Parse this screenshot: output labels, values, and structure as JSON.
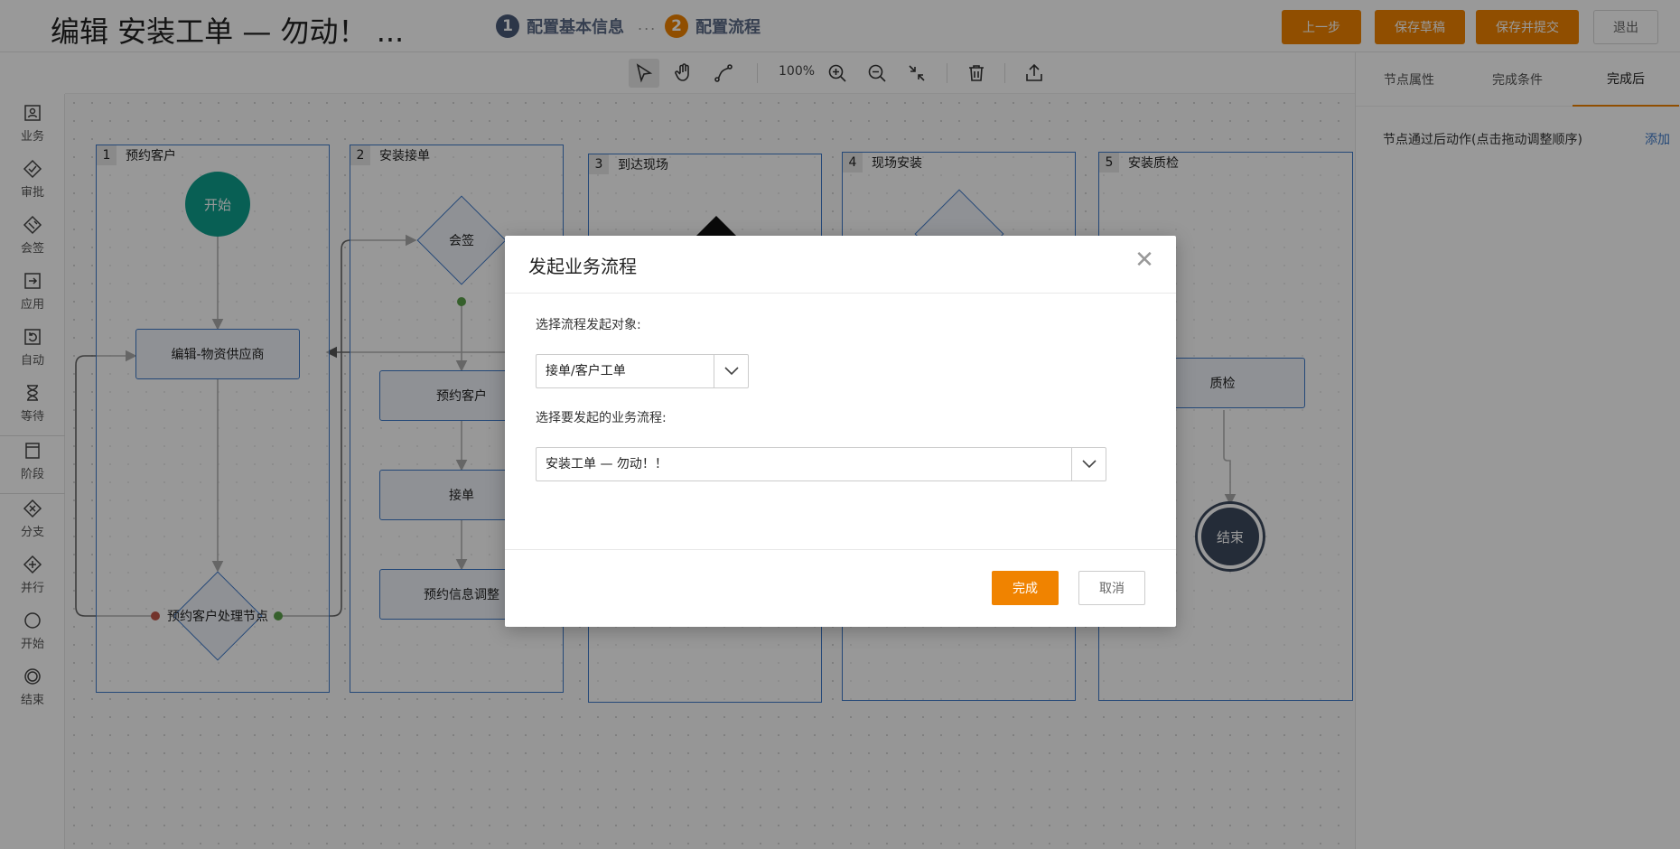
{
  "header": {
    "title": "编辑 安装工单 — 勿动！ ...",
    "steps": [
      {
        "num": "1",
        "label": "配置基本信息"
      },
      {
        "num": "2",
        "label": "配置流程"
      }
    ],
    "step_sep": "...",
    "buttons": {
      "prev": "上一步",
      "save_draft": "保存草稿",
      "save_submit": "保存并提交",
      "exit": "退出"
    }
  },
  "toolbar": {
    "zoom": "100%"
  },
  "palette": [
    "业务",
    "审批",
    "会签",
    "应用",
    "自动",
    "等待",
    "阶段",
    "分支",
    "并行",
    "开始",
    "结束"
  ],
  "lanes": [
    {
      "num": "1",
      "title": "预约客户"
    },
    {
      "num": "2",
      "title": "安装接单"
    },
    {
      "num": "3",
      "title": "到达现场"
    },
    {
      "num": "4",
      "title": "现场安装"
    },
    {
      "num": "5",
      "title": "安装质检"
    }
  ],
  "nodes": {
    "start": "开始",
    "edit_supplier": "编辑-物资供应商",
    "handle_node": "预约客户处理节点",
    "countersign": "会签",
    "book_customer": "预约客户",
    "accept_order": "接单",
    "adjust_info": "预约信息调整",
    "quality": "质检",
    "end": "结束"
  },
  "right_panel": {
    "tabs": [
      "节点属性",
      "完成条件",
      "完成后"
    ],
    "active_tab": "完成后",
    "desc": "节点通过后动作(点击拖动调整顺序)",
    "add": "添加"
  },
  "modal": {
    "title": "发起业务流程",
    "label_target": "选择流程发起对象:",
    "target_value": "接单/客户工单",
    "label_flow": "选择要发起的业务流程:",
    "flow_value": "安装工单 — 勿动！！",
    "ok": "完成",
    "cancel": "取消"
  },
  "colors": {
    "accent": "#f08300",
    "lane_border": "#3c78c8",
    "start": "#0e9e8c",
    "end": "#3d4a5e"
  }
}
